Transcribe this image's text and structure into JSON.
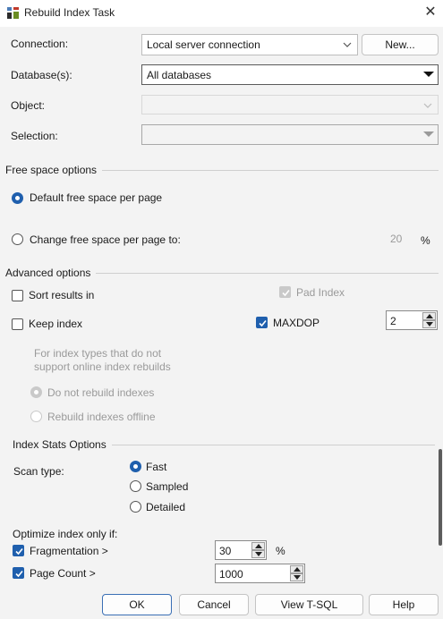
{
  "window": {
    "title": "Rebuild Index Task",
    "close_glyph": "✕"
  },
  "connection": {
    "label": "Connection:",
    "value": "Local server connection",
    "new_button": "New..."
  },
  "databases": {
    "label": "Database(s):",
    "value": "All databases"
  },
  "object": {
    "label": "Object:",
    "value": ""
  },
  "selection": {
    "label": "Selection:",
    "value": ""
  },
  "free_space": {
    "group_label": "Free space options",
    "default_option": "Default free space per page",
    "change_option": "Change free space per page to:",
    "value": "20",
    "unit": "%"
  },
  "advanced": {
    "group_label": "Advanced options",
    "sort_results": "Sort results in",
    "keep_index": "Keep index",
    "pad_index": "Pad Index",
    "maxdop_label": "MAXDOP",
    "maxdop_value": "2",
    "online_note_line1": "For index types that do not",
    "online_note_line2": "support online index rebuilds",
    "do_not_rebuild": "Do not rebuild indexes",
    "rebuild_offline": "Rebuild indexes offline"
  },
  "index_stats": {
    "group_label": "Index Stats Options",
    "scan_type_label": "Scan type:",
    "options": [
      "Fast",
      "Sampled",
      "Detailed"
    ],
    "selected": "Fast"
  },
  "optimize": {
    "label": "Optimize index only if:",
    "fragmentation_label": "Fragmentation >",
    "fragmentation_value": "30",
    "fragmentation_unit": "%",
    "page_count_label": "Page Count >",
    "page_count_value": "1000"
  },
  "buttons": {
    "ok": "OK",
    "cancel": "Cancel",
    "view_tsql": "View T-SQL",
    "help": "Help"
  },
  "colors": {
    "accent": "#1f5fad",
    "background": "#f3f3f3"
  }
}
